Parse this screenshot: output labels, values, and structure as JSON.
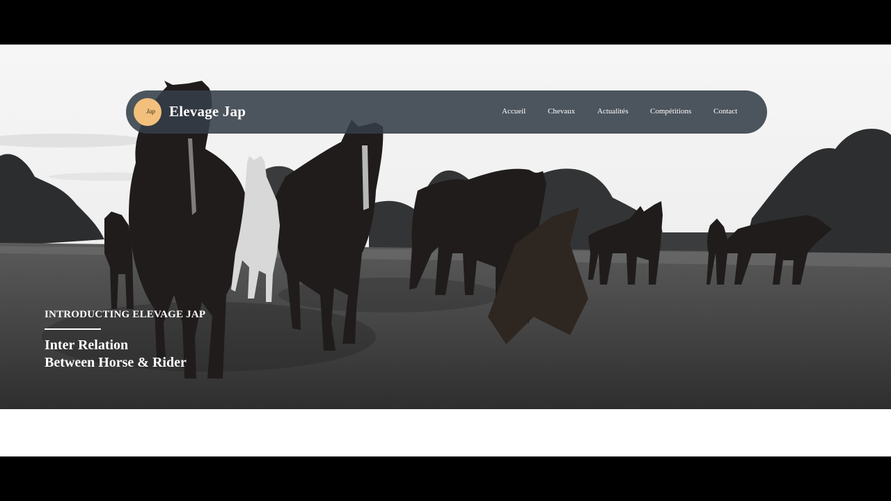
{
  "brand": {
    "logo_text": "Jap",
    "name": "Elevage Jap",
    "logo_color": "#f2c07c"
  },
  "nav": {
    "items": [
      {
        "label": "Accueil"
      },
      {
        "label": "Chevaux"
      },
      {
        "label": "Actualités"
      },
      {
        "label": "Compétitions"
      },
      {
        "label": "Contact"
      }
    ],
    "background": "#343e48"
  },
  "hero": {
    "kicker": "INTRODUCTING ELEVAGE JAP",
    "title_line1": "Inter Relation",
    "title_line2": "Between Horse & Rider",
    "image": "horse-herd-photo"
  }
}
